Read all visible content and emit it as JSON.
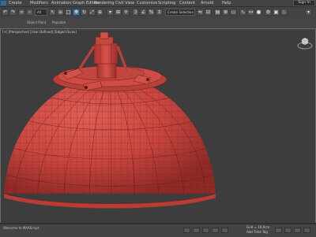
{
  "menu": {
    "items": [
      "Create",
      "Modifiers",
      "Animation",
      "Graph Editors",
      "Rendering",
      "Civil View",
      "Customize",
      "Scripting",
      "Content",
      "Arnold",
      "Help"
    ],
    "sign_in": "Sign In"
  },
  "toolbar": {
    "selection_dropdown": "All",
    "named_selection_dropdown": "Create Selection Se",
    "sublabels": [
      "Object Paint",
      "Populate"
    ]
  },
  "viewport": {
    "label": "[+] [Perspective] [User Defined] [Edged Faces]",
    "object_color": "#c9463f",
    "background_color": "#3d3d3d"
  },
  "status": {
    "left_text": "Welcome to MAXScript.",
    "right_text": "Add Time Tag",
    "coords": "Grid = 10.0cm"
  },
  "colors": {
    "accent": "#4a7cae",
    "object_red": "#c9463f"
  }
}
